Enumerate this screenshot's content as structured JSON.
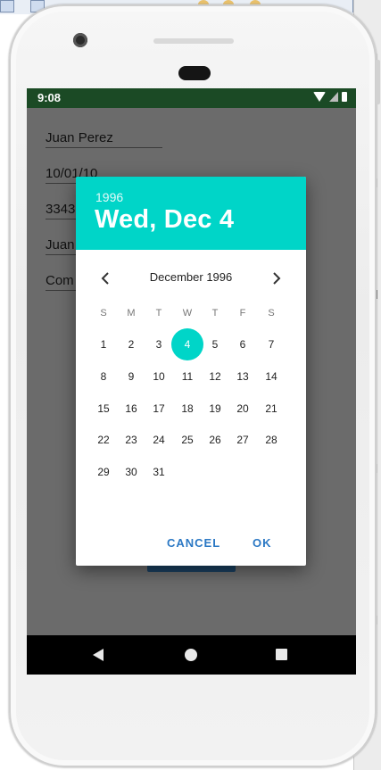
{
  "status": {
    "time": "9:08"
  },
  "form": {
    "name": "Juan Perez",
    "date": "10/01/10",
    "phone": "3343",
    "field4": "Juan",
    "field5": "Com"
  },
  "dialog": {
    "year": "1996",
    "selected_date": "Wed, Dec 4",
    "month_title": "December 1996",
    "weekdays": [
      "S",
      "M",
      "T",
      "W",
      "T",
      "F",
      "S"
    ],
    "days": [
      "1",
      "2",
      "3",
      "4",
      "5",
      "6",
      "7",
      "8",
      "9",
      "10",
      "11",
      "12",
      "13",
      "14",
      "15",
      "16",
      "17",
      "18",
      "19",
      "20",
      "21",
      "22",
      "23",
      "24",
      "25",
      "26",
      "27",
      "28",
      "29",
      "30",
      "31"
    ],
    "selected_day": 4,
    "cancel_label": "CANCEL",
    "ok_label": "OK"
  },
  "colors": {
    "accent": "#00d5c8",
    "button_text": "#2b78c4",
    "status_bar": "#1b4a25",
    "scrim": "#6b6b6b"
  },
  "icons": {
    "prev": "chevron-left-icon",
    "next": "chevron-right-icon",
    "back": "back-triangle-icon",
    "home": "home-circle-icon",
    "recents": "recents-square-icon"
  }
}
